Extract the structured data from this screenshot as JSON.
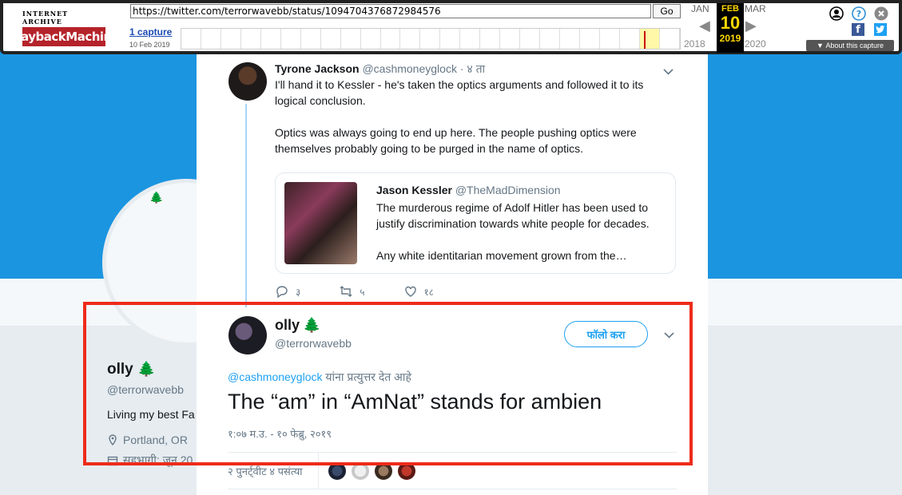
{
  "wayback": {
    "logo_top": "INTERNET ARCHIVE",
    "logo_main": "WaybackMachine",
    "url": "https://twitter.com/terrorwavebb/status/1094704376872984576",
    "go_label": "Go",
    "captures": "1 capture",
    "capture_date": "10 Feb 2019",
    "prev_month": "JAN",
    "cur_month": "FEB",
    "cur_day": "10",
    "next_month": "MAR",
    "prev_year": "2018",
    "cur_year": "2019",
    "next_year": "2020",
    "about": "About this capture"
  },
  "profile": {
    "name": "olly",
    "handle": "@terrorwavebb",
    "bio": "Living my best Fa",
    "location": "Portland, OR",
    "joined": "सहभागी: जून 20"
  },
  "tweet_parent": {
    "name": "Tyrone Jackson",
    "handle": "@cashmoneyglock",
    "time": "· ४ ता",
    "text_p1": "I'll hand it to Kessler - he's taken the optics arguments and followed it to its logical conclusion.",
    "text_p2": "Optics was always going to end up here. The people pushing optics were themselves probably going to be purged in the name of optics.",
    "quote": {
      "name": "Jason Kessler",
      "handle": "@TheMadDimension",
      "text_p1": "The murderous regime of Adolf Hitler has been used to justify discrimination towards white people for decades.",
      "text_p2": "Any white identitarian movement grown from the…"
    },
    "replies": "३",
    "retweets": "५",
    "likes": "१८"
  },
  "tweet_main": {
    "name": "olly",
    "handle": "@terrorwavebb",
    "follow_label": "फॉलो करा",
    "replying_handle": "@cashmoneyglock",
    "replying_suffix": " यांना प्रत्युत्तर देत आहे",
    "text": "The “am” in “AmNat” stands for ambien",
    "timestamp": "१:०७ म.उ. - १० फेब्रु, २०१९",
    "stats": "२ पुनर्ट्वीट   ४ पसंत्या"
  },
  "colors": {
    "twitter_blue": "#1da1f2",
    "banner": "#1b95e0",
    "highlight": "#ee2b1a",
    "wayback_yellow": "#ffd800"
  }
}
